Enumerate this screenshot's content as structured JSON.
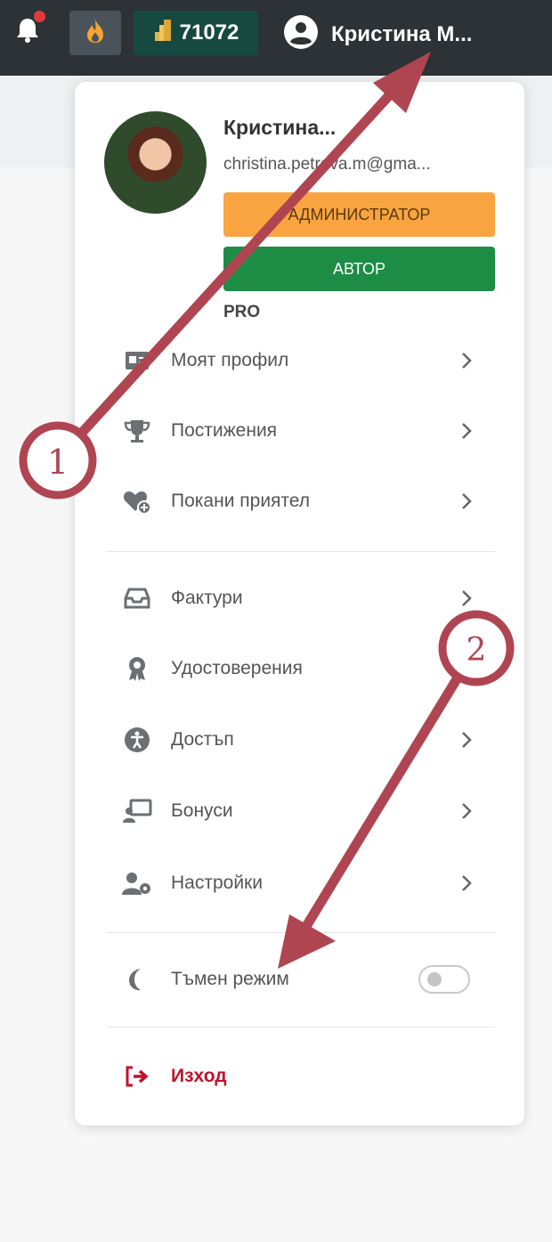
{
  "topbar": {
    "coins": "71072",
    "user_name": "Кристина М..."
  },
  "menu": {
    "name": "Кристина...",
    "email": "christina.petrova.m@gma...",
    "roles": [
      "АДМИНИСТРАТОР",
      "АВТОР"
    ],
    "plan": "PRO",
    "section1": [
      {
        "label": "Моят профил",
        "icon": "profile-card-icon"
      },
      {
        "label": "Постижения",
        "icon": "trophy-icon"
      },
      {
        "label": "Покани приятел",
        "icon": "heart-plus-icon"
      }
    ],
    "section2": [
      {
        "label": "Фактури",
        "icon": "inbox-tray-icon"
      },
      {
        "label": "Удостоверения",
        "icon": "award-icon"
      },
      {
        "label": "Достъп",
        "icon": "accessibility-icon"
      },
      {
        "label": "Бонуси",
        "icon": "chalkboard-user-icon"
      },
      {
        "label": "Настройки",
        "icon": "user-gear-icon"
      }
    ],
    "dark_mode_label": "Тъмен режим",
    "dark_mode_on": false,
    "logout_label": "Изход"
  },
  "callouts": [
    {
      "number": "1"
    },
    {
      "number": "2"
    }
  ],
  "colors": {
    "topbar": "#2c3236",
    "admin_badge": "#f8a541",
    "author_badge": "#1d8c45",
    "coins_bg": "#164a40",
    "logout": "#c0132e",
    "callout": "#b04552",
    "notification_dot": "#e23a3a"
  }
}
